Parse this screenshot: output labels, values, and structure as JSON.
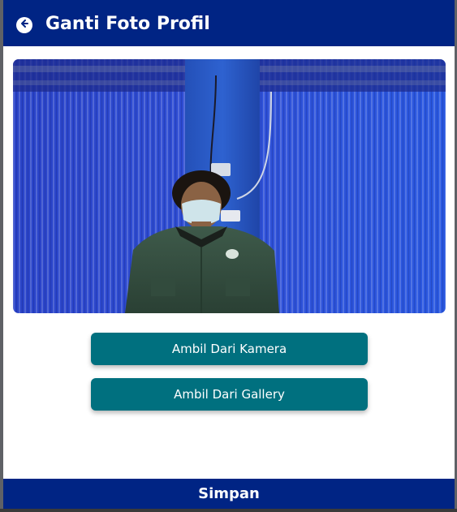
{
  "header": {
    "title": "Ganti Foto Profil",
    "back_icon": "arrow-left-circle-icon"
  },
  "photo": {
    "description_icon": "profile-photo"
  },
  "actions": {
    "camera_label": "Ambil Dari Kamera",
    "gallery_label": "Ambil Dari Gallery"
  },
  "footer": {
    "save_label": "Simpan"
  },
  "colors": {
    "header_bg": "#002484",
    "button_bg": "#00707f",
    "text_light": "#ffffff"
  }
}
